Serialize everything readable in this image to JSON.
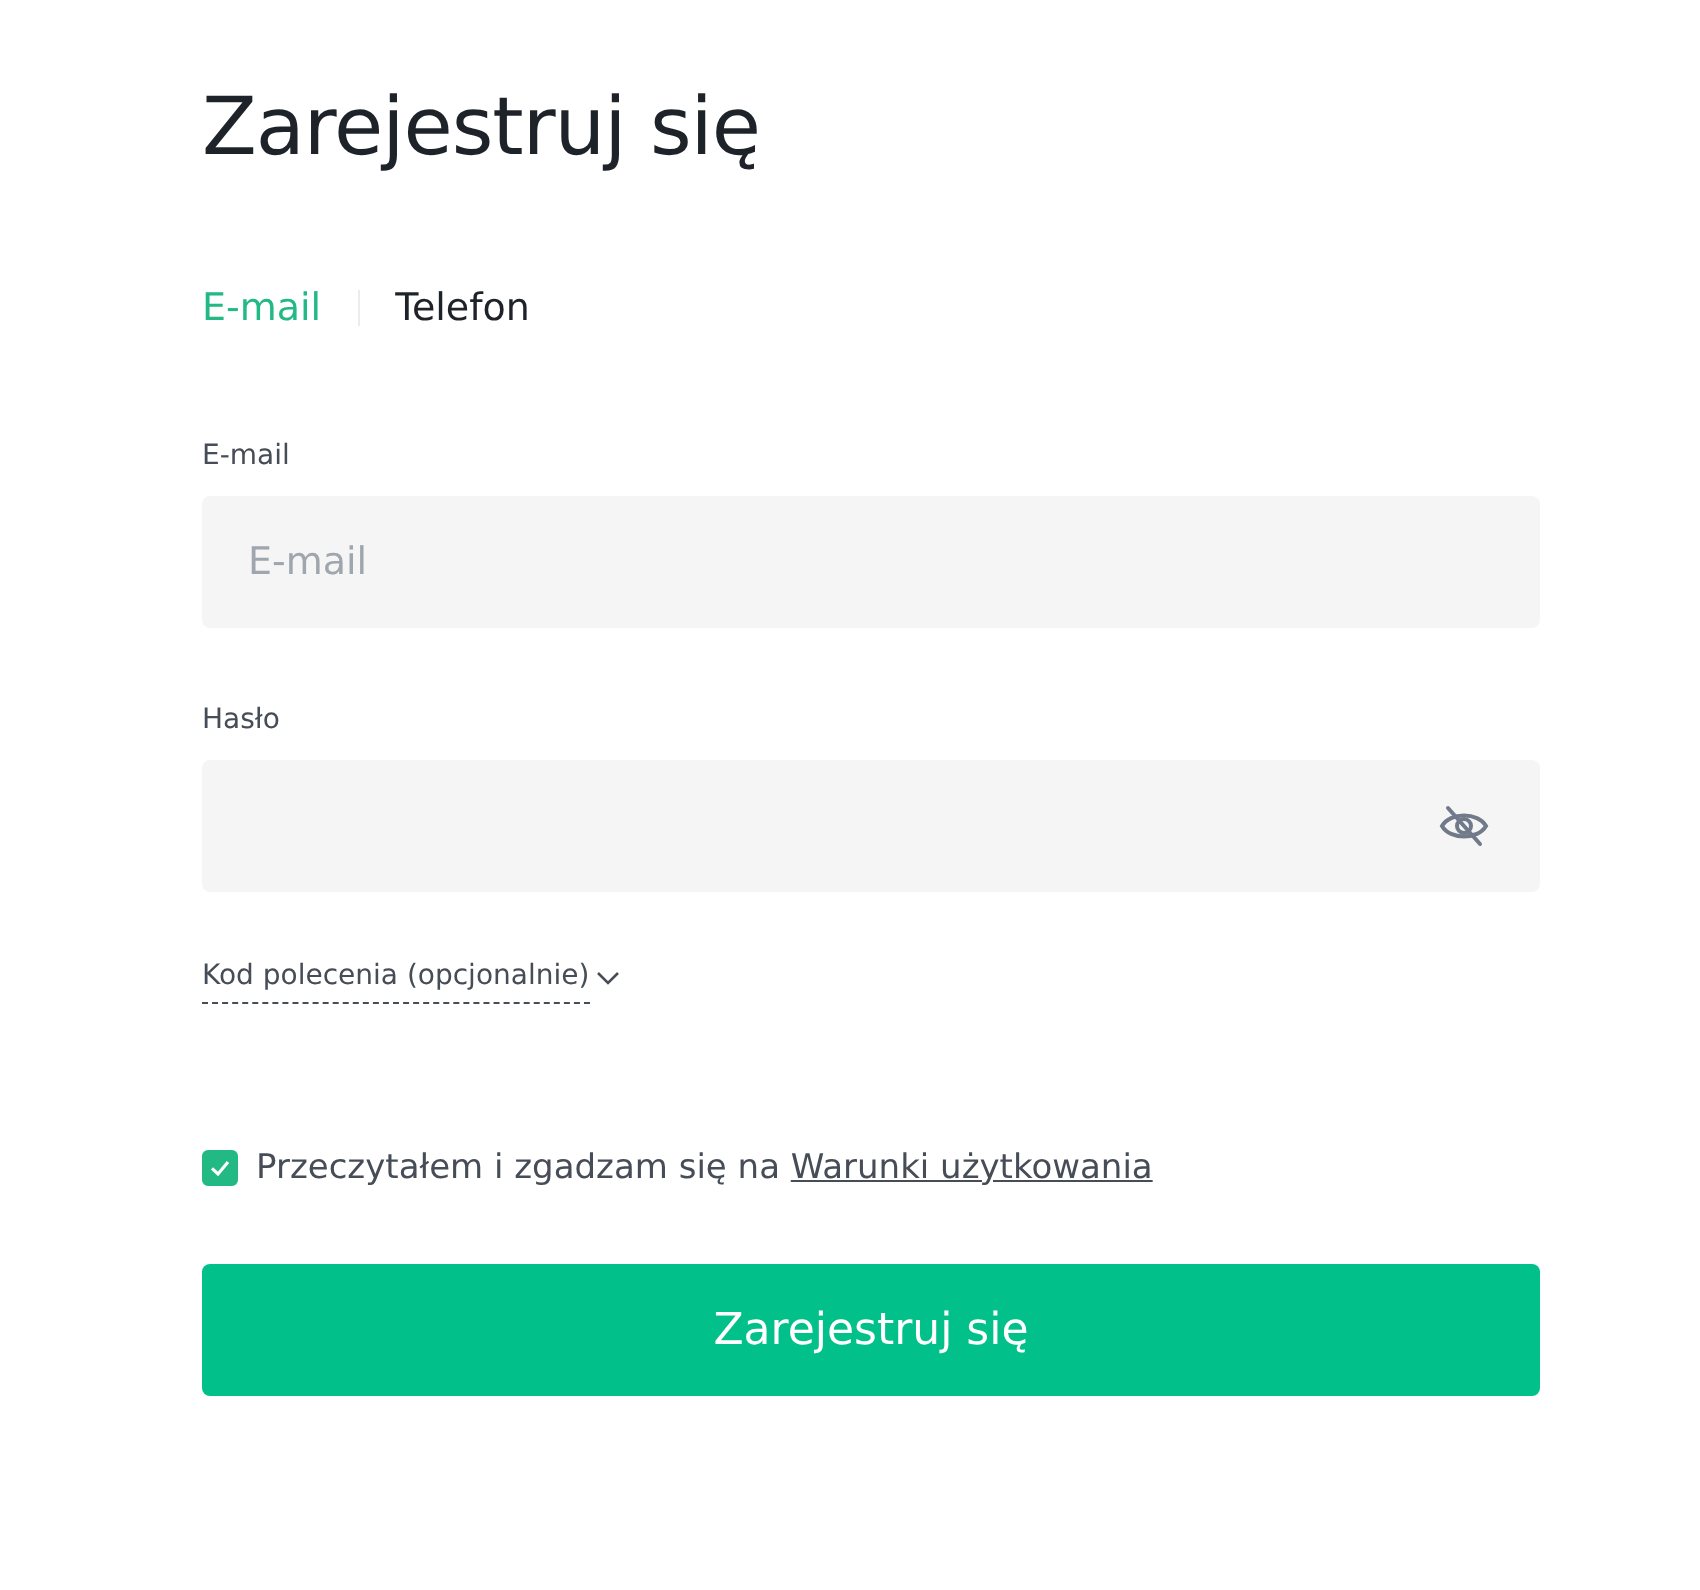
{
  "title": "Zarejestruj się",
  "tabs": [
    {
      "label": "E-mail",
      "selected": true
    },
    {
      "label": "Telefon",
      "selected": false
    }
  ],
  "fields": [
    {
      "label": "E-mail",
      "placeholder": "E-mail",
      "kind": "text"
    },
    {
      "label": "Hasło",
      "kind": "password"
    }
  ],
  "referral": {
    "label": "Kod polecenia (opcjonalnie)"
  },
  "agreement": {
    "checked": true,
    "text": "Przeczytałem i zgadzam się na ",
    "link": "Warunki użytkowania"
  },
  "submit": "Zarejestruj się"
}
